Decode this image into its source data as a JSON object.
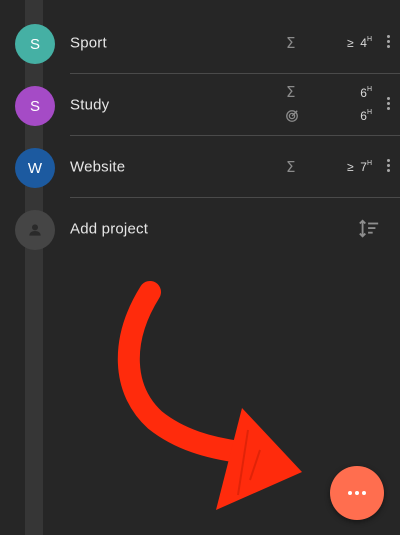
{
  "projects": [
    {
      "initial": "S",
      "name": "Sport",
      "color": "#45b0a4",
      "stats": [
        {
          "icon": "sigma-icon",
          "prefix": "≥",
          "value": "4",
          "unit": "H"
        }
      ]
    },
    {
      "initial": "S",
      "name": "Study",
      "color": "#a54bc6",
      "stats": [
        {
          "icon": "sigma-icon",
          "prefix": "",
          "value": "6",
          "unit": "H"
        },
        {
          "icon": "target-icon",
          "prefix": "",
          "value": "6",
          "unit": "H"
        }
      ]
    },
    {
      "initial": "W",
      "name": "Website",
      "color": "#1c5aa0",
      "stats": [
        {
          "icon": "sigma-icon",
          "prefix": "≥",
          "value": "7",
          "unit": "H"
        }
      ]
    }
  ],
  "add_project": {
    "label": "Add project",
    "icon": "person-icon"
  },
  "sort_icon": "sort-icon",
  "sigma_symbol": "Σ",
  "fab": {
    "icon": "more-horizontal-icon",
    "color": "#ff6e4f"
  },
  "annotation": {
    "icon": "curved-arrow-icon",
    "color": "#ff2b0c"
  }
}
